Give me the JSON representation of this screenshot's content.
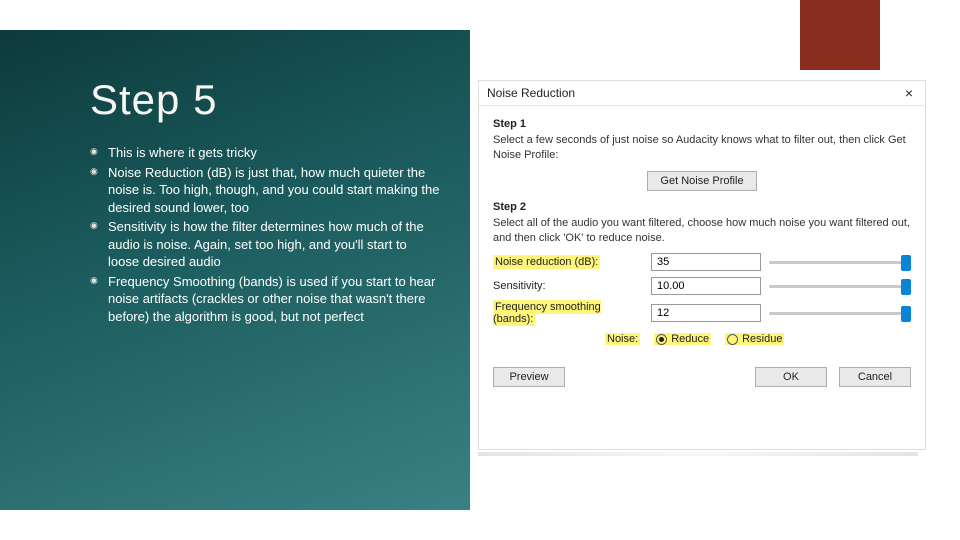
{
  "slide": {
    "title": "Step 5",
    "bullets": [
      "This is where it gets tricky",
      "Noise Reduction (dB) is just that, how much quieter the noise is. Too high, though, and you could start making the desired sound lower, too",
      "Sensitivity is how the filter determines how much of the audio is noise. Again, set too high, and you'll start to loose desired audio",
      "Frequency Smoothing (bands) is used if you start to hear noise artifacts (crackles or other noise that wasn't there before) the algorithm is good, but not perfect"
    ]
  },
  "dialog": {
    "title": "Noise Reduction",
    "close": "×",
    "step1": {
      "label": "Step 1",
      "text": "Select a few seconds of just noise so Audacity knows what to filter out, then click Get Noise Profile:",
      "button": "Get Noise Profile"
    },
    "step2": {
      "label": "Step 2",
      "text": "Select all of the audio you want filtered, choose how much noise you want filtered out, and then click 'OK' to reduce noise."
    },
    "fields": {
      "reduction": {
        "label": "Noise reduction (dB):",
        "value": "35"
      },
      "sensitivity": {
        "label": "Sensitivity:",
        "value": "10.00"
      },
      "smoothing": {
        "label": "Frequency smoothing (bands):",
        "value": "12"
      }
    },
    "noise": {
      "label": "Noise:",
      "reduce": "Reduce",
      "residue": "Residue"
    },
    "buttons": {
      "preview": "Preview",
      "ok": "OK",
      "cancel": "Cancel"
    }
  }
}
